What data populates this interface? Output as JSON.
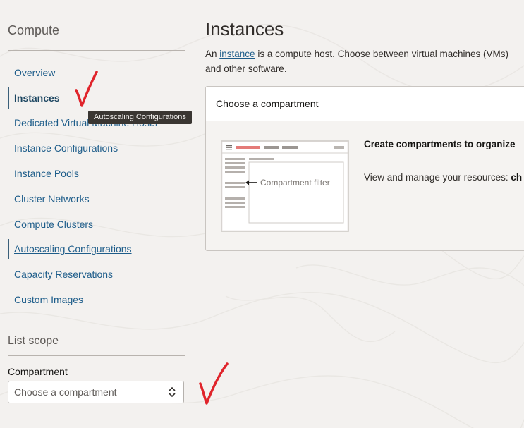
{
  "sidebar": {
    "heading": "Compute",
    "items": [
      {
        "label": "Overview",
        "state": "default"
      },
      {
        "label": "Instances",
        "state": "active"
      },
      {
        "label": "Dedicated Virtual Machine Hosts",
        "state": "default"
      },
      {
        "label": "Instance Configurations",
        "state": "default"
      },
      {
        "label": "Instance Pools",
        "state": "default"
      },
      {
        "label": "Cluster Networks",
        "state": "default"
      },
      {
        "label": "Compute Clusters",
        "state": "default"
      },
      {
        "label": "Autoscaling Configurations",
        "state": "hovered"
      },
      {
        "label": "Capacity Reservations",
        "state": "default"
      },
      {
        "label": "Custom Images",
        "state": "default"
      }
    ],
    "scope_heading": "List scope",
    "compartment_label": "Compartment",
    "compartment_placeholder": "Choose a compartment"
  },
  "tooltip": {
    "text": "Autoscaling Configurations"
  },
  "main": {
    "title": "Instances",
    "intro_prefix": "An ",
    "intro_link": "instance",
    "intro_rest": " is a compute host. Choose between virtual machines (VMs)",
    "intro_line2": "and other software.",
    "card": {
      "header": "Choose a compartment",
      "illustration_label": "Compartment filter",
      "title": "Create compartments to organize",
      "body": "View and manage your resources: ",
      "body_bold": "ch"
    }
  },
  "colors": {
    "link": "#1e5d8a",
    "annotation_check": "#e0242b",
    "accent_bar": "#e47b78"
  },
  "icons": {
    "select": "chevron-up-down-icon",
    "hamburger": "hamburger-icon",
    "arrow": "arrow-left-icon"
  }
}
